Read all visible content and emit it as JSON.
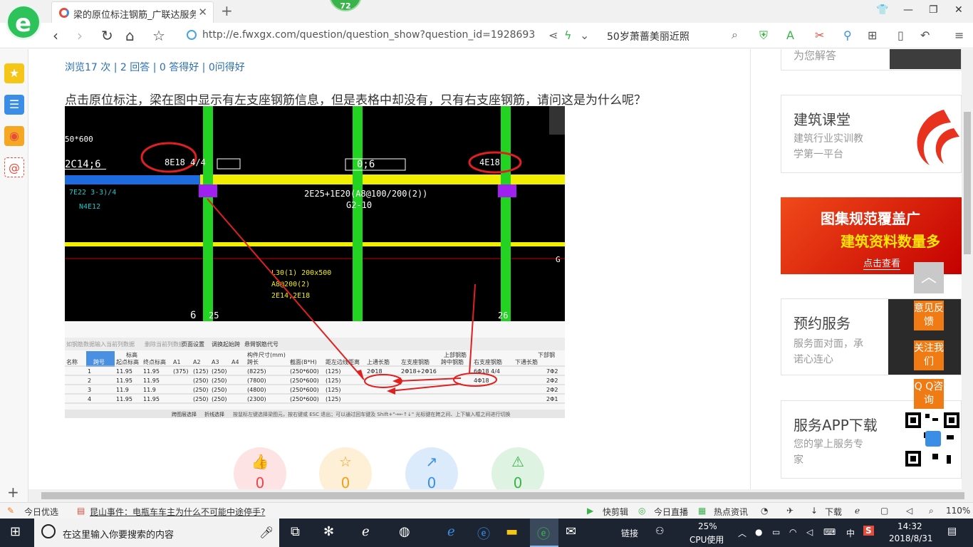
{
  "browser": {
    "tab_title": "梁的原位标注钢筋_广联达服务新",
    "tab_close": "✕",
    "new_tab": "+",
    "badge": "72",
    "url": "http://e.fwxgx.com/question/question_show?question_id=1928693",
    "search_query": "50岁萧蔷美丽近照"
  },
  "question": {
    "stats": "浏览17 次 | 2 回答 | 0 答得好 | 0问得好",
    "text": "点击原位标注，梁在图中显示有左支座钢筋信息，但是表格中却没有，只有右支座钢筋，请问这是为什么呢？"
  },
  "cad": {
    "labels": {
      "size_left": "50*600",
      "beam_left": "2C14;6",
      "anno_left": "8E18 4/4",
      "anno_center": "0;6",
      "anno_right": "4E18",
      "beam_spec": "2E25+1E20(A8@100/200(2))",
      "beam_name": "G2-10",
      "col_num_1": "25",
      "col_num_2": "26",
      "col_num_0": "6",
      "axis_g": "G",
      "l30": "L30(1) 200x500",
      "l30b": "A8@200(2)",
      "l30c": "2E14;2E18",
      "beam_left2": "7E22 3-3)/4",
      "beam_left3": "N4E12"
    },
    "toolbar": [
      "如钢筋数据",
      "输入当前列数据",
      "删除当前列数据",
      "页面设置",
      "调换起始跨",
      "悬臂钢筋代号"
    ],
    "table": {
      "group_headers": [
        "标高",
        "构件尺寸(mm)",
        "上部钢筋",
        "下部钢"
      ],
      "headers": [
        "名称",
        "跨号",
        "起点标高",
        "终点标高",
        "A1",
        "A2",
        "A3",
        "A4",
        "跨长",
        "截面(B*H)",
        "距左边线距离",
        "上通长筋",
        "左支座钢筋",
        "跨中钢筋",
        "右支座钢筋",
        "下通长筋"
      ],
      "rows": [
        [
          "",
          "1",
          "11.95",
          "11.95",
          "(375)",
          "(125)",
          "(250)",
          "",
          "(8225)",
          "(250*600)",
          "(125)",
          "2Φ18",
          "2Φ18+2Φ16",
          "",
          "6Φ18 4/4",
          "",
          "7Φ2"
        ],
        [
          "",
          "2",
          "11.95",
          "11.95",
          "",
          "(250)",
          "(250)",
          "",
          "(7800)",
          "(250*600)",
          "(125)",
          "",
          "",
          "",
          "4Φ18",
          "",
          "2Φ2"
        ],
        [
          "",
          "3",
          "11.9",
          "11.9",
          "",
          "(250)",
          "(250)",
          "",
          "(4800)",
          "(250*600)",
          "(125)",
          "",
          "",
          "",
          "",
          "",
          "2Φ2"
        ],
        [
          "",
          "4",
          "11.95",
          "11.95",
          "",
          "(250)",
          "(250)",
          "",
          "(2300)",
          "(250*600)",
          "(125)",
          "",
          "",
          "",
          "",
          "",
          "2Φ1"
        ]
      ]
    },
    "status_text": "按鼠标左键选择梁图元，按右键或 ESC 退出；可以通过回车键及 Shift+\"→←↑↓\" 光标键在跨之间、上下输入框之间进行切换",
    "status_buttons": [
      "跨图层选择",
      "折线选择"
    ]
  },
  "actions": [
    {
      "icon": "👍",
      "count": "0",
      "color": "#e8484b",
      "bg": "#fde3e3"
    },
    {
      "icon": "☆",
      "count": "0",
      "color": "#f0a020",
      "bg": "#fdf0d6"
    },
    {
      "icon": "↗",
      "count": "0",
      "color": "#3a8ee6",
      "bg": "#dcebfb"
    },
    {
      "icon": "⚠",
      "count": "0",
      "color": "#3ab44a",
      "bg": "#dff3e2"
    }
  ],
  "right": {
    "top_card_text": "为您解答",
    "card1": {
      "title": "建筑课堂",
      "desc1": "建筑行业实训教",
      "desc2": "学第一平台"
    },
    "banner": {
      "line1": "图集规范覆盖广",
      "line2": "建筑资料数量多",
      "cta": "点击查看"
    },
    "card2": {
      "title": "预约服务",
      "desc1": "服务面对面，承",
      "desc2": "诺心连心"
    },
    "card3": {
      "title": "服务APP下载",
      "desc1": "您的掌上服务专",
      "desc2": "家"
    },
    "float": {
      "top": "︿",
      "feedback": "意见反馈",
      "follow": "关注我们",
      "qq": "Q Q咨询"
    }
  },
  "statusbar": {
    "daily": "今日优选",
    "news": "昆山事件：电瓶车车主为什么不可能中途停手?",
    "clip": "快剪辑",
    "live": "今日直播",
    "hot": "热点资讯",
    "download": "下载",
    "zoom": "110%"
  },
  "taskbar": {
    "search_placeholder": "在这里输入你要搜索的内容",
    "link": "链接",
    "cpu_pct": "25%",
    "cpu_label": "CPU使用",
    "ime": "中",
    "time": "14:32",
    "date": "2018/8/31"
  },
  "colors": {
    "accent_orange": "#f07a13",
    "link_blue": "#2a6fb8",
    "taskbar": "#1b2430"
  }
}
